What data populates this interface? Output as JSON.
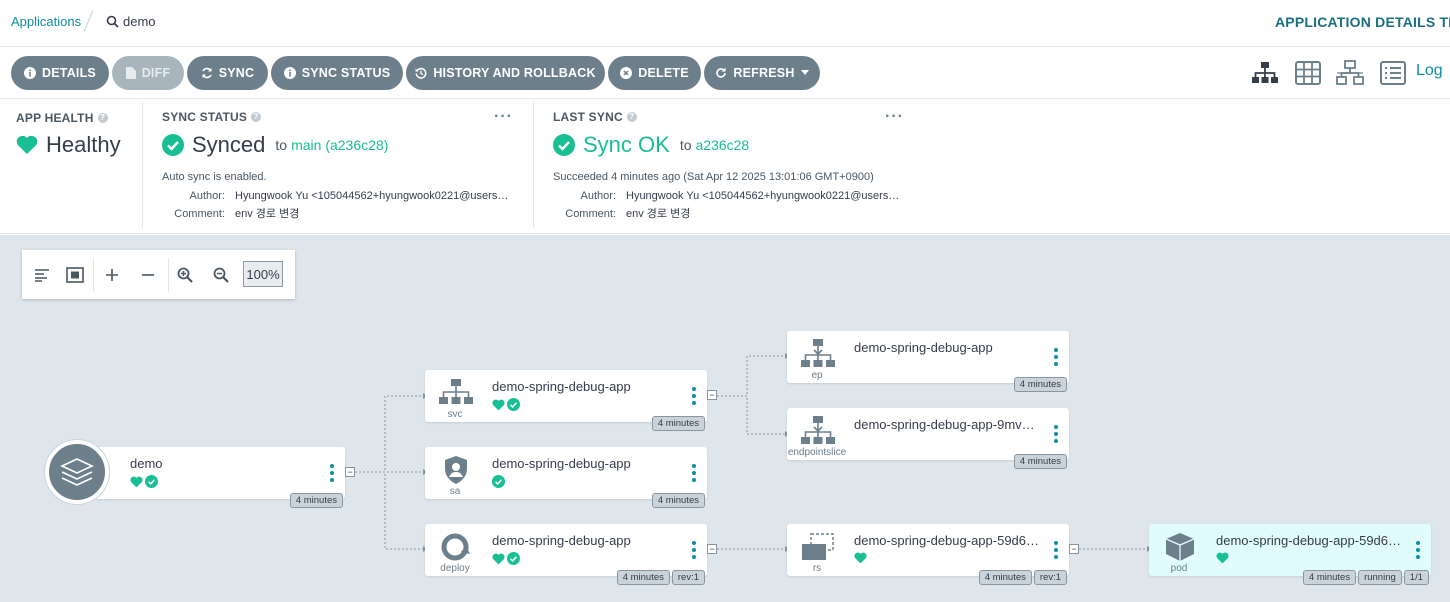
{
  "breadcrumb": {
    "applications": "Applications",
    "current": "demo"
  },
  "header": {
    "title": "APPLICATION DETAILS TR",
    "logs_link": "Log"
  },
  "actions": {
    "details": "DETAILS",
    "diff": "DIFF",
    "sync": "SYNC",
    "sync_status": "SYNC STATUS",
    "history": "HISTORY AND ROLLBACK",
    "delete": "DELETE",
    "refresh": "REFRESH"
  },
  "view_icons": [
    "tree-view-icon",
    "pods-view-icon",
    "network-view-icon",
    "list-view-icon"
  ],
  "app_health": {
    "title": "APP HEALTH",
    "value": "Healthy",
    "color": "#18be94"
  },
  "sync_status": {
    "title": "SYNC STATUS",
    "value": "Synced",
    "to": "to",
    "revision": "main (a236c28)",
    "auto_sync": "Auto sync is enabled.",
    "author_label": "Author:",
    "author": "Hyungwook Yu <105044562+hyungwook0221@users…",
    "comment_label": "Comment:",
    "comment": "env 경로 변경"
  },
  "last_sync": {
    "title": "LAST SYNC",
    "value": "Sync OK",
    "to": "to",
    "revision": "a236c28",
    "succeeded": "Succeeded 4 minutes ago (Sat Apr 12 2025 13:01:06 GMT+0900)",
    "author_label": "Author:",
    "author": "Hyungwook Yu <105044562+hyungwook0221@users…",
    "comment_label": "Comment:",
    "comment": "env 경로 변경"
  },
  "graph": {
    "zoom": "100%",
    "app": {
      "name": "demo",
      "age": "4 minutes"
    },
    "nodes": {
      "svc": {
        "name": "demo-spring-debug-app",
        "kind": "svc",
        "age": "4 minutes"
      },
      "sa": {
        "name": "demo-spring-debug-app",
        "kind": "sa",
        "age": "4 minutes"
      },
      "deploy": {
        "name": "demo-spring-debug-app",
        "kind": "deploy",
        "age": "4 minutes",
        "rev": "rev:1"
      },
      "ep": {
        "name": "demo-spring-debug-app",
        "kind": "ep",
        "age": "4 minutes"
      },
      "endpointslice": {
        "name": "demo-spring-debug-app-9mv…",
        "kind": "endpointslice",
        "age": "4 minutes"
      },
      "rs": {
        "name": "demo-spring-debug-app-59d6…",
        "kind": "rs",
        "age": "4 minutes",
        "rev": "rev:1"
      },
      "pod": {
        "name": "demo-spring-debug-app-59d6…",
        "kind": "pod",
        "age": "4 minutes",
        "status": "running",
        "ready": "1/1"
      }
    }
  },
  "colors": {
    "accent": "#0d8ea3",
    "healthy": "#18be94",
    "button": "#6d7f8b"
  }
}
